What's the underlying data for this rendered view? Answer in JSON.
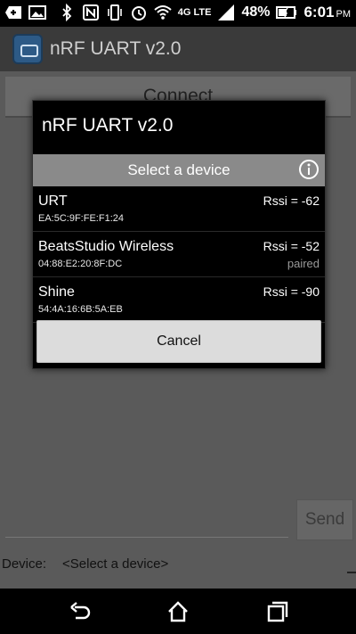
{
  "status_bar": {
    "battery_percent": "48%",
    "time": "6:01",
    "time_suffix": "PM",
    "network_label": "4G LTE",
    "icons": [
      "add-icon",
      "gallery-icon",
      "bluetooth-icon",
      "nfc-icon",
      "vibrate-icon",
      "alarm-icon",
      "wifi-icon",
      "network-4g-icon",
      "signal-icon",
      "battery-icon"
    ]
  },
  "app": {
    "title": "nRF UART v2.0",
    "connect_label": "Connect",
    "send_label": "Send",
    "device_label": "Device:",
    "device_value": "<Select a device>"
  },
  "dialog": {
    "title": "nRF UART v2.0",
    "header_label": "Select a device",
    "devices": [
      {
        "name": "URT",
        "address": "EA:5C:9F:FE:F1:24",
        "rssi": "Rssi = -62",
        "status": ""
      },
      {
        "name": "BeatsStudio Wireless",
        "address": "04:88:E2:20:8F:DC",
        "rssi": "Rssi = -52",
        "status": "paired"
      },
      {
        "name": "Shine",
        "address": "54:4A:16:6B:5A:EB",
        "rssi": "Rssi = -90",
        "status": ""
      }
    ],
    "cancel_label": "Cancel"
  },
  "nav": {
    "icons": [
      "back-icon",
      "home-icon",
      "recents-icon"
    ]
  }
}
